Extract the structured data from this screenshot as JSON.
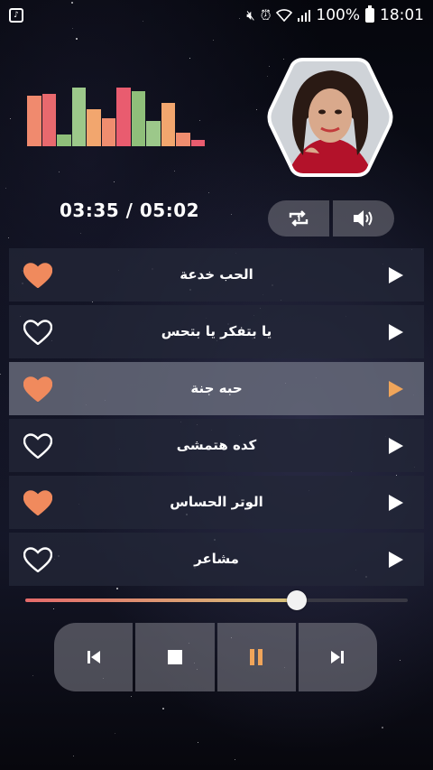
{
  "status_bar": {
    "battery": "100%",
    "clock": "18:01",
    "icons": [
      "app-notification-icon",
      "mute-icon",
      "alarm-icon",
      "wifi-icon",
      "signal-icon",
      "battery-icon"
    ]
  },
  "equalizer": {
    "levels": [
      0.75,
      0.78,
      0.18,
      0.88,
      0.55,
      0.42,
      0.88,
      0.82,
      0.38,
      0.65,
      0.2,
      0.1
    ],
    "colors": [
      "#f08a6e",
      "#e8696e",
      "#8fbf7a",
      "#9cc88a",
      "#f2a66e",
      "#ef8d6f",
      "#e95c6f",
      "#8fbf7a",
      "#9cc88a",
      "#f2a66e",
      "#ef8d6f",
      "#e95c6f"
    ]
  },
  "player": {
    "time_display": "03:35 / 05:02",
    "progress": 0.71,
    "repeat_icon": "repeat-one-icon",
    "volume_icon": "volume-icon"
  },
  "tracks": [
    {
      "title": "الحب خدعة",
      "favorite": true,
      "active": false
    },
    {
      "title": "يا بتفكر يا بتحس",
      "favorite": false,
      "active": false
    },
    {
      "title": "حبه جنة",
      "favorite": true,
      "active": true
    },
    {
      "title": "كده هتمشى",
      "favorite": false,
      "active": false
    },
    {
      "title": "الوتر الحساس",
      "favorite": true,
      "active": false
    },
    {
      "title": "مشاعر",
      "favorite": false,
      "active": false
    }
  ],
  "controls": [
    "previous-icon",
    "stop-icon",
    "pause-icon",
    "next-icon"
  ],
  "colors": {
    "accent": "#f08a5d",
    "play_white": "#ffffff",
    "pause_accent": "#f0a55a"
  }
}
